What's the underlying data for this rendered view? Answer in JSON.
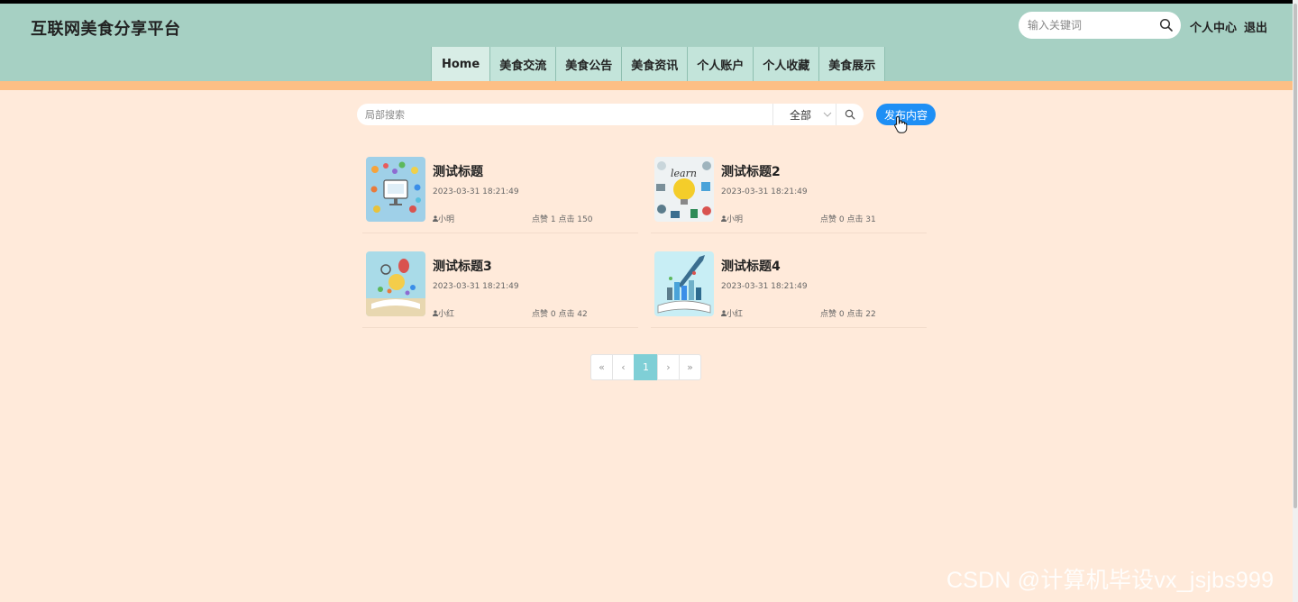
{
  "site": {
    "title": "互联网美食分享平台"
  },
  "top_search": {
    "placeholder": "输入关键词"
  },
  "top_links": {
    "user_center": "个人中心",
    "logout": "退出"
  },
  "nav": {
    "items": [
      "Home",
      "美食交流",
      "美食公告",
      "美食资讯",
      "个人账户",
      "个人收藏",
      "美食展示"
    ]
  },
  "local_search": {
    "placeholder": "局部搜索",
    "select_value": "全部"
  },
  "publish_button": "发布内容",
  "cards": [
    {
      "title": "测试标题",
      "date": "2023-03-31 18:21:49",
      "author": "小明",
      "stats": "点赞 1 点击 150"
    },
    {
      "title": "测试标题2",
      "date": "2023-03-31 18:21:49",
      "author": "小明",
      "stats": "点赞 0 点击 31"
    },
    {
      "title": "测试标题3",
      "date": "2023-03-31 18:21:49",
      "author": "小红",
      "stats": "点赞 0 点击 42"
    },
    {
      "title": "测试标题4",
      "date": "2023-03-31 18:21:49",
      "author": "小红",
      "stats": "点赞 0 点击 22"
    }
  ],
  "pagination": {
    "first": "«",
    "prev": "‹",
    "current": "1",
    "next": "›",
    "last": "»"
  },
  "watermark": "CSDN @计算机毕设vx_jsjbs999",
  "colors": {
    "header": "#a6d0c3",
    "stripe": "#fdbf85",
    "page_bg": "#ffeada",
    "primary": "#1e8ff5",
    "page_active": "#7fcfd6"
  }
}
